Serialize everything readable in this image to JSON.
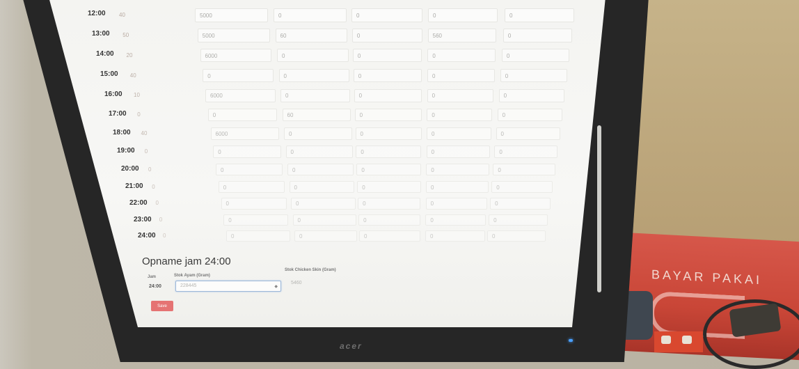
{
  "times": [
    "12:00",
    "13:00",
    "14:00",
    "15:00",
    "16:00",
    "17:00",
    "18:00",
    "19:00",
    "20:00",
    "21:00",
    "22:00",
    "23:00",
    "24:00"
  ],
  "rows": [
    [
      "40",
      "5000",
      "0",
      "0",
      "0",
      "0"
    ],
    [
      "50",
      "5000",
      "60",
      "0",
      "560",
      "0"
    ],
    [
      "20",
      "6000",
      "0",
      "0",
      "0",
      "0"
    ],
    [
      "40",
      "0",
      "0",
      "0",
      "0",
      "0"
    ],
    [
      "10",
      "6000",
      "0",
      "0",
      "0",
      "0"
    ],
    [
      "0",
      "0",
      "60",
      "0",
      "0",
      "0"
    ],
    [
      "40",
      "6000",
      "0",
      "0",
      "0",
      "0"
    ],
    [
      "0",
      "0",
      "0",
      "0",
      "0",
      "0"
    ],
    [
      "0",
      "0",
      "0",
      "0",
      "0",
      "0"
    ],
    [
      "0",
      "0",
      "0",
      "0",
      "0",
      "0"
    ],
    [
      "0",
      "0",
      "0",
      "0",
      "0",
      "0"
    ],
    [
      "0",
      "0",
      "0",
      "0",
      "0",
      "0"
    ],
    [
      "0",
      "0",
      "0",
      "0",
      "0",
      "0"
    ]
  ],
  "opname": {
    "title": "Opname jam 24:00",
    "col_jam": "Jam",
    "col_stok_ayam": "Stok Ayam (Gram)",
    "col_stok_skin": "Stok Chicken Skin (Gram)",
    "jam_value": "24:00",
    "stok_ayam_value": "228445",
    "stok_skin_value": "5460",
    "save_label": "Save"
  },
  "monitor_brand": "acer",
  "box_text": "BAYAR PAKAI"
}
